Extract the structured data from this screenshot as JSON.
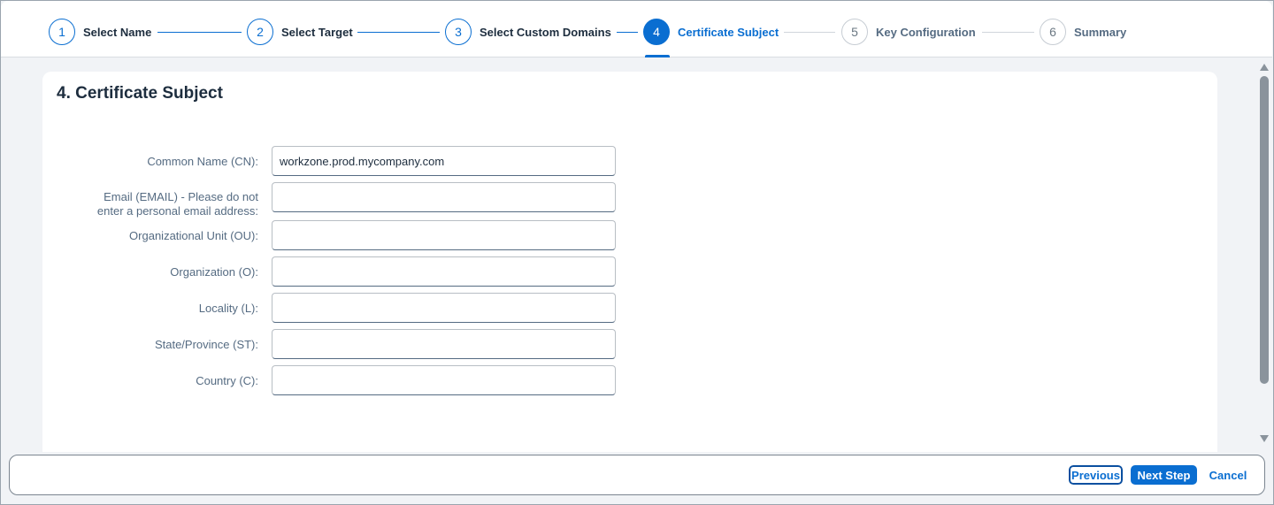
{
  "wizard": {
    "steps": [
      {
        "number": "1",
        "label": "Select Name"
      },
      {
        "number": "2",
        "label": "Select Target"
      },
      {
        "number": "3",
        "label": "Select Custom Domains"
      },
      {
        "number": "4",
        "label": "Certificate Subject"
      },
      {
        "number": "5",
        "label": "Key Configuration"
      },
      {
        "number": "6",
        "label": "Summary"
      }
    ],
    "active_step": 4
  },
  "form": {
    "title": "4. Certificate Subject",
    "fields": [
      {
        "label": "Common Name (CN):",
        "value": "workzone.prod.mycompany.com"
      },
      {
        "label_line1": "Email (EMAIL) - Please do not",
        "label_line2": "enter a personal email address:",
        "value": ""
      },
      {
        "label": "Organizational Unit (OU):",
        "value": ""
      },
      {
        "label": "Organization (O):",
        "value": ""
      },
      {
        "label": "Locality (L):",
        "value": ""
      },
      {
        "label": "State/Province (ST):",
        "value": ""
      },
      {
        "label": "Country (C):",
        "value": ""
      }
    ]
  },
  "footer": {
    "previous_label": "Previous",
    "next_label": "Next Step",
    "cancel_label": "Cancel"
  },
  "colors": {
    "accent": "#0a6ed1",
    "text": "#1d2d3e",
    "label": "#556b82"
  }
}
